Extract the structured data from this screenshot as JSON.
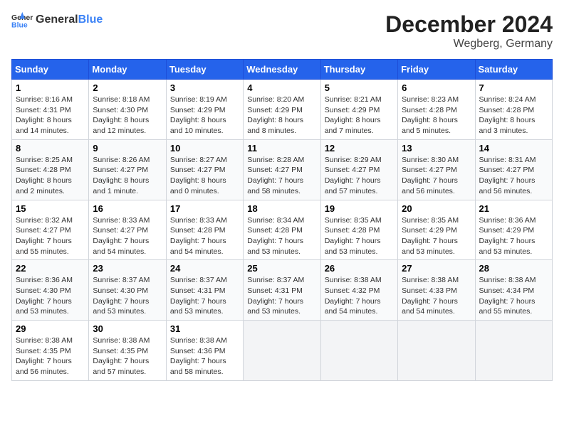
{
  "logo": {
    "general": "General",
    "blue": "Blue"
  },
  "title": "December 2024",
  "subtitle": "Wegberg, Germany",
  "days_header": [
    "Sunday",
    "Monday",
    "Tuesday",
    "Wednesday",
    "Thursday",
    "Friday",
    "Saturday"
  ],
  "weeks": [
    [
      {
        "day": "1",
        "sunrise": "8:16 AM",
        "sunset": "4:31 PM",
        "daylight": "8 hours and 14 minutes."
      },
      {
        "day": "2",
        "sunrise": "8:18 AM",
        "sunset": "4:30 PM",
        "daylight": "8 hours and 12 minutes."
      },
      {
        "day": "3",
        "sunrise": "8:19 AM",
        "sunset": "4:29 PM",
        "daylight": "8 hours and 10 minutes."
      },
      {
        "day": "4",
        "sunrise": "8:20 AM",
        "sunset": "4:29 PM",
        "daylight": "8 hours and 8 minutes."
      },
      {
        "day": "5",
        "sunrise": "8:21 AM",
        "sunset": "4:29 PM",
        "daylight": "8 hours and 7 minutes."
      },
      {
        "day": "6",
        "sunrise": "8:23 AM",
        "sunset": "4:28 PM",
        "daylight": "8 hours and 5 minutes."
      },
      {
        "day": "7",
        "sunrise": "8:24 AM",
        "sunset": "4:28 PM",
        "daylight": "8 hours and 3 minutes."
      }
    ],
    [
      {
        "day": "8",
        "sunrise": "8:25 AM",
        "sunset": "4:28 PM",
        "daylight": "8 hours and 2 minutes."
      },
      {
        "day": "9",
        "sunrise": "8:26 AM",
        "sunset": "4:27 PM",
        "daylight": "8 hours and 1 minute."
      },
      {
        "day": "10",
        "sunrise": "8:27 AM",
        "sunset": "4:27 PM",
        "daylight": "8 hours and 0 minutes."
      },
      {
        "day": "11",
        "sunrise": "8:28 AM",
        "sunset": "4:27 PM",
        "daylight": "7 hours and 58 minutes."
      },
      {
        "day": "12",
        "sunrise": "8:29 AM",
        "sunset": "4:27 PM",
        "daylight": "7 hours and 57 minutes."
      },
      {
        "day": "13",
        "sunrise": "8:30 AM",
        "sunset": "4:27 PM",
        "daylight": "7 hours and 56 minutes."
      },
      {
        "day": "14",
        "sunrise": "8:31 AM",
        "sunset": "4:27 PM",
        "daylight": "7 hours and 56 minutes."
      }
    ],
    [
      {
        "day": "15",
        "sunrise": "8:32 AM",
        "sunset": "4:27 PM",
        "daylight": "7 hours and 55 minutes."
      },
      {
        "day": "16",
        "sunrise": "8:33 AM",
        "sunset": "4:27 PM",
        "daylight": "7 hours and 54 minutes."
      },
      {
        "day": "17",
        "sunrise": "8:33 AM",
        "sunset": "4:28 PM",
        "daylight": "7 hours and 54 minutes."
      },
      {
        "day": "18",
        "sunrise": "8:34 AM",
        "sunset": "4:28 PM",
        "daylight": "7 hours and 53 minutes."
      },
      {
        "day": "19",
        "sunrise": "8:35 AM",
        "sunset": "4:28 PM",
        "daylight": "7 hours and 53 minutes."
      },
      {
        "day": "20",
        "sunrise": "8:35 AM",
        "sunset": "4:29 PM",
        "daylight": "7 hours and 53 minutes."
      },
      {
        "day": "21",
        "sunrise": "8:36 AM",
        "sunset": "4:29 PM",
        "daylight": "7 hours and 53 minutes."
      }
    ],
    [
      {
        "day": "22",
        "sunrise": "8:36 AM",
        "sunset": "4:30 PM",
        "daylight": "7 hours and 53 minutes."
      },
      {
        "day": "23",
        "sunrise": "8:37 AM",
        "sunset": "4:30 PM",
        "daylight": "7 hours and 53 minutes."
      },
      {
        "day": "24",
        "sunrise": "8:37 AM",
        "sunset": "4:31 PM",
        "daylight": "7 hours and 53 minutes."
      },
      {
        "day": "25",
        "sunrise": "8:37 AM",
        "sunset": "4:31 PM",
        "daylight": "7 hours and 53 minutes."
      },
      {
        "day": "26",
        "sunrise": "8:38 AM",
        "sunset": "4:32 PM",
        "daylight": "7 hours and 54 minutes."
      },
      {
        "day": "27",
        "sunrise": "8:38 AM",
        "sunset": "4:33 PM",
        "daylight": "7 hours and 54 minutes."
      },
      {
        "day": "28",
        "sunrise": "8:38 AM",
        "sunset": "4:34 PM",
        "daylight": "7 hours and 55 minutes."
      }
    ],
    [
      {
        "day": "29",
        "sunrise": "8:38 AM",
        "sunset": "4:35 PM",
        "daylight": "7 hours and 56 minutes."
      },
      {
        "day": "30",
        "sunrise": "8:38 AM",
        "sunset": "4:35 PM",
        "daylight": "7 hours and 57 minutes."
      },
      {
        "day": "31",
        "sunrise": "8:38 AM",
        "sunset": "4:36 PM",
        "daylight": "7 hours and 58 minutes."
      },
      null,
      null,
      null,
      null
    ]
  ]
}
